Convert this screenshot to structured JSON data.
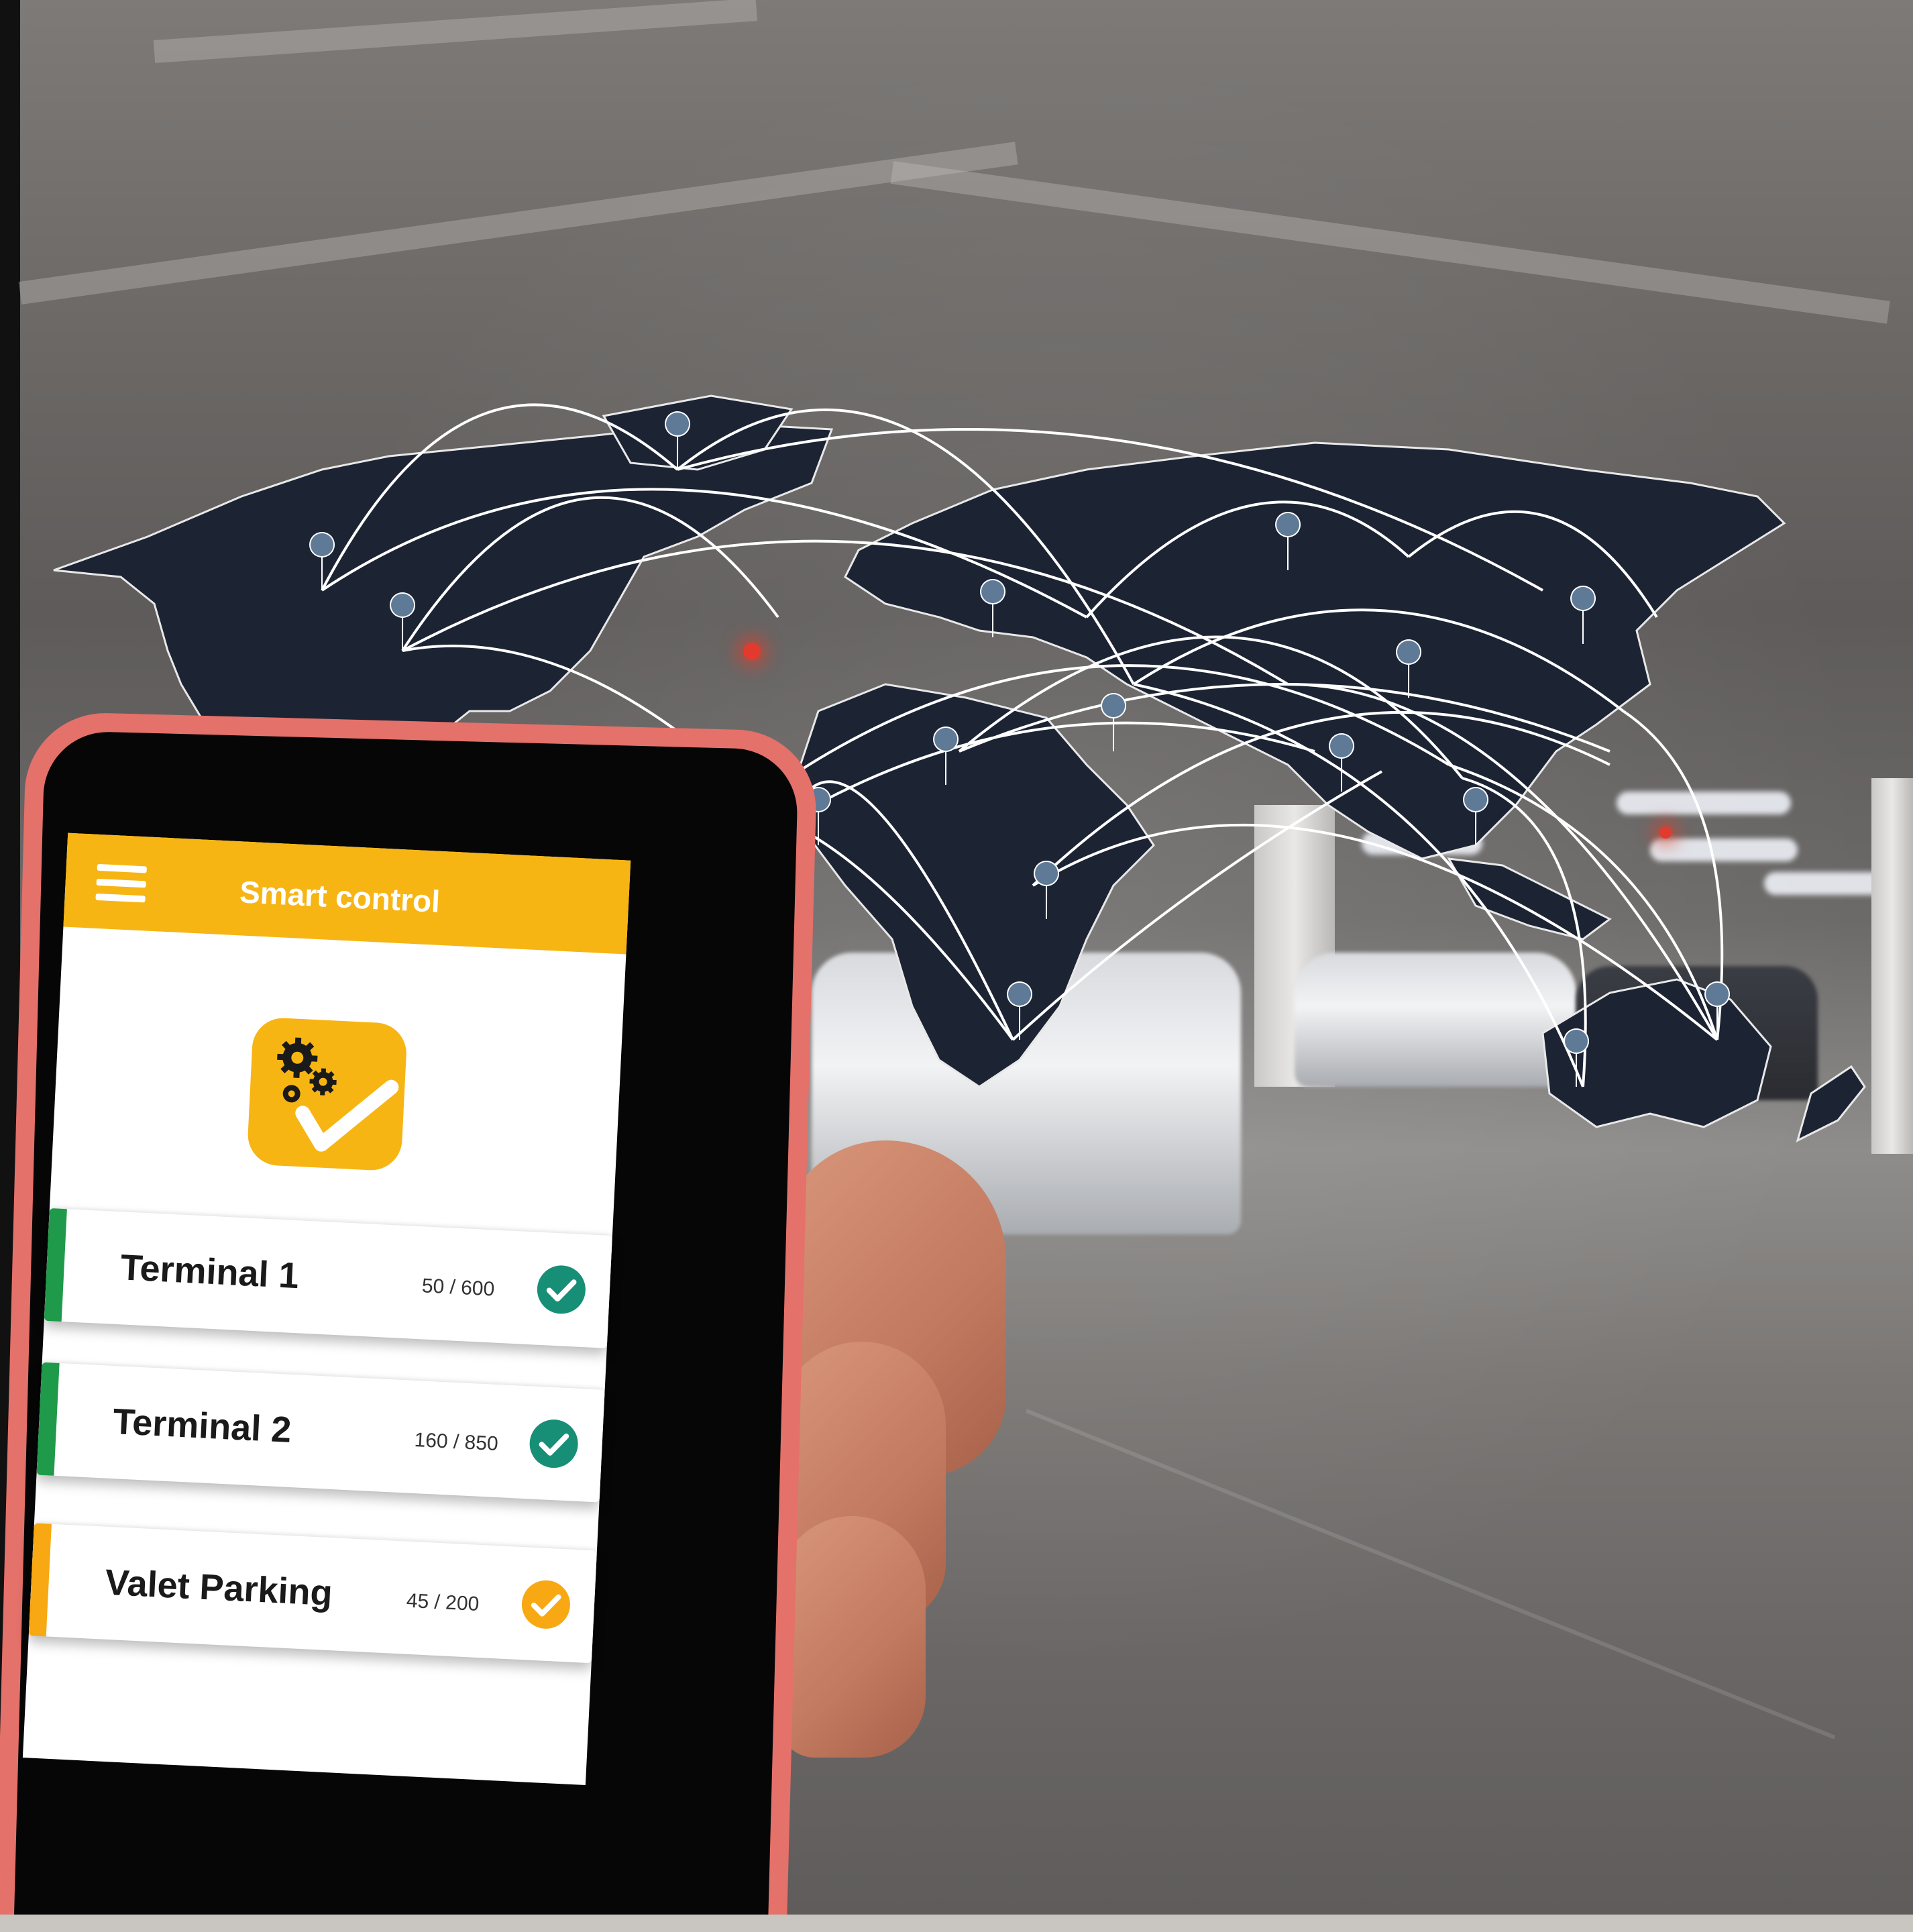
{
  "app": {
    "title": "Smart control",
    "accent_color": "#f7b514"
  },
  "icons": {
    "menu": "hamburger-menu-icon",
    "logo": "gears-checkmark-logo-icon",
    "status": "check-circle-icon"
  },
  "parking_areas": [
    {
      "name": "Terminal 1",
      "count": "50 / 600",
      "status_color": "#1f9a4a",
      "check_color": "#178f76"
    },
    {
      "name": "Terminal 2",
      "count": "160 / 850",
      "status_color": "#1f9a4a",
      "check_color": "#178f76"
    },
    {
      "name": "Valet Parking",
      "count": "45 / 200",
      "status_color": "#f7a813",
      "check_color": "#f7a813"
    }
  ]
}
